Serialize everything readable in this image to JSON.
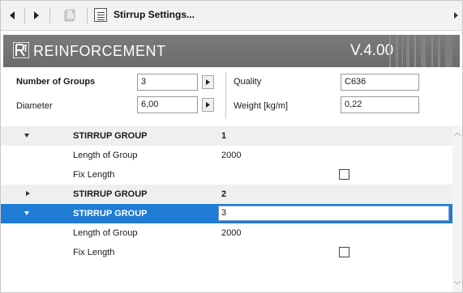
{
  "toolbar": {
    "title": "Stirrup Settings..."
  },
  "banner": {
    "logo_text": "R",
    "title": "REINFORCEMENT",
    "version": "V.4.00"
  },
  "form": {
    "number_of_groups_label": "Number of Groups",
    "number_of_groups_value": "3",
    "diameter_label": "Diameter",
    "diameter_value": "6,00",
    "quality_label": "Quality",
    "quality_value": "C636",
    "weight_label": "Weight [kg/m]",
    "weight_value": "0,22"
  },
  "tree": {
    "rows": [
      {
        "kind": "group",
        "expanded": true,
        "name": "STIRRUP GROUP",
        "value": "1"
      },
      {
        "kind": "item",
        "name": "Length of Group",
        "value": "2000"
      },
      {
        "kind": "item",
        "name": "Fix Length",
        "checked": false
      },
      {
        "kind": "group",
        "expanded": false,
        "name": "STIRRUP GROUP",
        "value": "2"
      },
      {
        "kind": "group",
        "expanded": true,
        "selected": true,
        "name": "STIRRUP GROUP",
        "value": "3"
      },
      {
        "kind": "item",
        "name": "Length of Group",
        "value": "2000"
      },
      {
        "kind": "item",
        "name": "Fix Length",
        "checked": false
      }
    ]
  },
  "colors": {
    "selection": "#1f7bd3",
    "banner": "#737373",
    "group_row": "#efefef"
  }
}
